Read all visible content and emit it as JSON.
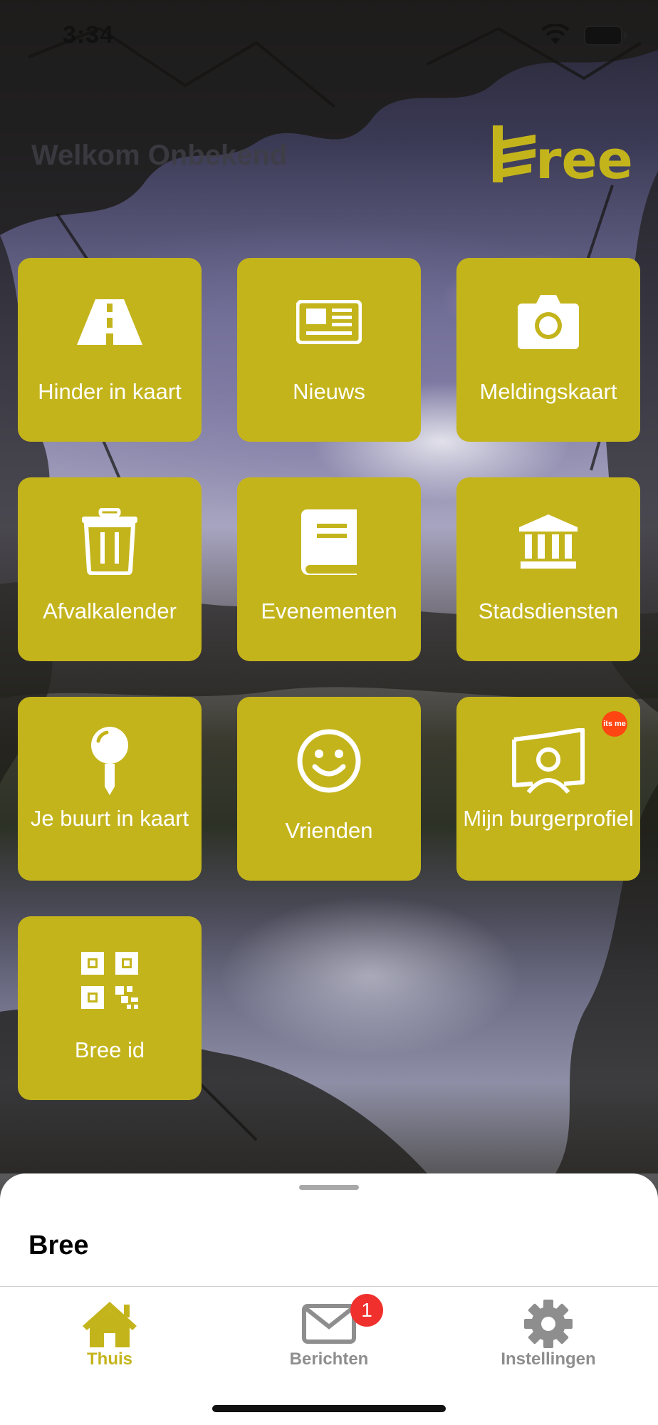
{
  "status_bar": {
    "time": "3:34"
  },
  "header": {
    "welcome": "Welkom Onbekend",
    "logo_text": "bree"
  },
  "tiles": [
    {
      "label": "Hinder in kaart",
      "icon": "road-icon"
    },
    {
      "label": "Nieuws",
      "icon": "newspaper-icon"
    },
    {
      "label": "Meldingskaart",
      "icon": "camera-icon"
    },
    {
      "label": "Afvalkalender",
      "icon": "trash-icon"
    },
    {
      "label": "Evenementen",
      "icon": "book-icon"
    },
    {
      "label": "Stadsdiensten",
      "icon": "bank-icon"
    },
    {
      "label": "Je buurt in kaart",
      "icon": "map-pin-icon"
    },
    {
      "label": "Vrienden",
      "icon": "smiley-icon"
    },
    {
      "label": "Mijn burgerprofiel",
      "icon": "profile-card-icon",
      "badge": "its me"
    },
    {
      "label": "Bree id",
      "icon": "qr-code-icon"
    }
  ],
  "sheet": {
    "title": "Bree"
  },
  "tabbar": {
    "items": [
      {
        "label": "Thuis",
        "icon": "home-icon",
        "active": true
      },
      {
        "label": "Berichten",
        "icon": "mail-icon",
        "badge": "1"
      },
      {
        "label": "Instellingen",
        "icon": "gear-icon"
      }
    ]
  },
  "colors": {
    "accent": "#c4b41c",
    "tab_active": "#c4b41c",
    "tab_inactive": "#8e8e8e",
    "badge_red": "#f0302c",
    "itsme_orange": "#ff4612"
  }
}
